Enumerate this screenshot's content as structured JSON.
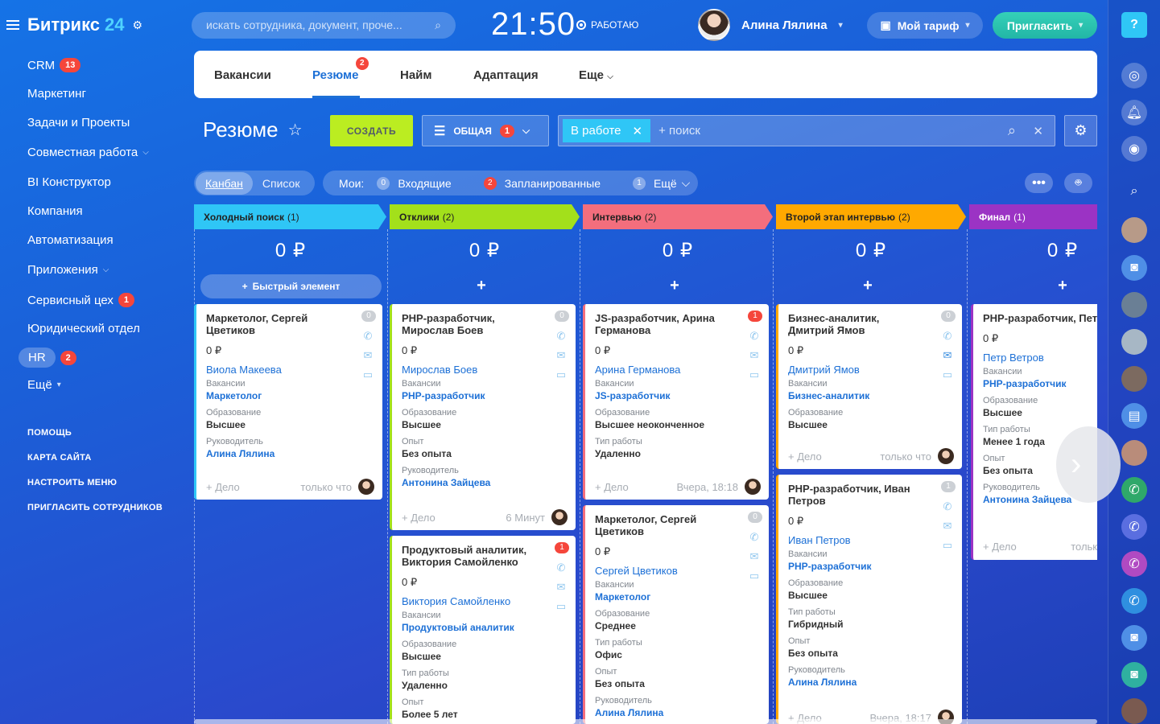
{
  "logo": {
    "name": "Битрикс",
    "num": "24"
  },
  "sidebar": {
    "items": [
      {
        "label": "CRM",
        "badge": "13"
      },
      {
        "label": "Маркетинг"
      },
      {
        "label": "Задачи и Проекты"
      },
      {
        "label": "Совместная работа"
      },
      {
        "label": "BI Конструктор"
      },
      {
        "label": "Компания"
      },
      {
        "label": "Автоматизация"
      },
      {
        "label": "Приложения"
      },
      {
        "label": "Сервисный цех",
        "badge": "1"
      },
      {
        "label": "Юридический отдел"
      },
      {
        "label": "HR",
        "badge": "2"
      },
      {
        "label": "Ещё"
      }
    ],
    "links": [
      "ПОМОЩЬ",
      "КАРТА САЙТА",
      "НАСТРОИТЬ МЕНЮ",
      "ПРИГЛАСИТЬ СОТРУДНИКОВ"
    ]
  },
  "header": {
    "search_placeholder": "искать сотрудника, документ, проче...",
    "clock": "21:50",
    "work_status": "РАБОТАЮ",
    "user_name": "Алина Лялина",
    "tariff": "Мой тариф",
    "invite": "Пригласить"
  },
  "tabs": [
    {
      "label": "Вакансии"
    },
    {
      "label": "Резюме",
      "badge": "2"
    },
    {
      "label": "Найм"
    },
    {
      "label": "Адаптация"
    },
    {
      "label": "Еще"
    }
  ],
  "toolbar": {
    "title": "Резюме",
    "create": "СОЗДАТЬ",
    "filter": "ОБЩАЯ",
    "filter_count": "1",
    "chip": "В работе",
    "search_placeholder": "+ поиск"
  },
  "view": {
    "kanban": "Канбан",
    "list": "Список",
    "mine": "Мои:",
    "incoming": "Входящие",
    "incoming_count": "0",
    "planned": "Запланированные",
    "planned_count": "2",
    "more": "Ещё",
    "more_count": "1"
  },
  "quick_add": "Быстрый элемент",
  "columns": [
    {
      "name": "Холодный поиск",
      "count": "(1)",
      "sum": "0 ₽",
      "color": "#2fc6f6"
    },
    {
      "name": "Отклики",
      "count": "(2)",
      "sum": "0 ₽",
      "color": "#a3e01b"
    },
    {
      "name": "Интервью",
      "count": "(2)",
      "sum": "0 ₽",
      "color": "#f36e7d"
    },
    {
      "name": "Второй этап интервью",
      "count": "(2)",
      "sum": "0 ₽",
      "color": "#ffa900"
    },
    {
      "name": "Финал",
      "count": "(1)",
      "sum": "0 ₽",
      "color": "#9b33c4"
    }
  ],
  "cards": {
    "c1": {
      "title": "Маркетолог, Сергей Цветиков",
      "sum": "0 ₽",
      "contact": "Виола Макеева",
      "badge": "0",
      "l1": "Вакансии",
      "v1": "Маркетолог",
      "l2": "Образование",
      "v2": "Высшее",
      "l3": "Руководитель",
      "v3": "Алина Лялина",
      "add": "+ Дело",
      "time": "только что"
    },
    "c2": {
      "title": "PHP-разработчик, Мирослав Боев",
      "sum": "0 ₽",
      "contact": "Мирослав Боев",
      "badge": "0",
      "l1": "Вакансии",
      "v1": "PHP-разработчик",
      "l2": "Образование",
      "v2": "Высшее",
      "l3": "Опыт",
      "v3": "Без опыта",
      "l4": "Руководитель",
      "v4": "Антонина Зайцева",
      "add": "+ Дело",
      "time": "6 Минут"
    },
    "c3": {
      "title": "Продуктовый аналитик, Виктория Самойленко",
      "sum": "0 ₽",
      "contact": "Виктория Самойленко",
      "badge": "1",
      "l1": "Вакансии",
      "v1": "Продуктовый аналитик",
      "l2": "Образование",
      "v2": "Высшее",
      "l3": "Тип работы",
      "v3": "Удаленно",
      "l4": "Опыт",
      "v4": "Более 5 лет"
    },
    "c4": {
      "title": "JS-разработчик, Арина Германова",
      "sum": "0 ₽",
      "contact": "Арина Германова",
      "badge": "1",
      "l1": "Вакансии",
      "v1": "JS-разработчик",
      "l2": "Образование",
      "v2": "Высшее неоконченное",
      "l3": "Тип работы",
      "v3": "Удаленно",
      "add": "+ Дело",
      "time": "Вчера, 18:18"
    },
    "c5": {
      "title": "Маркетолог, Сергей Цветиков",
      "sum": "0 ₽",
      "contact": "Сергей Цветиков",
      "badge": "0",
      "l1": "Вакансии",
      "v1": "Маркетолог",
      "l2": "Образование",
      "v2": "Среднее",
      "l3": "Тип работы",
      "v3": "Офис",
      "l4": "Опыт",
      "v4": "Без опыта",
      "l5": "Руководитель",
      "v5": "Алина Лялина"
    },
    "c6": {
      "title": "Бизнес-аналитик, Дмитрий Ямов",
      "sum": "0 ₽",
      "contact": "Дмитрий Ямов",
      "badge": "0",
      "l1": "Вакансии",
      "v1": "Бизнес-аналитик",
      "l2": "Образование",
      "v2": "Высшее",
      "add": "+ Дело",
      "time": "только что"
    },
    "c7": {
      "title": "PHP-разработчик, Иван Петров",
      "sum": "0 ₽",
      "contact": "Иван Петров",
      "badge": "1",
      "l1": "Вакансии",
      "v1": "PHP-разработчик",
      "l2": "Образование",
      "v2": "Высшее",
      "l3": "Тип работы",
      "v3": "Гибридный",
      "l4": "Опыт",
      "v4": "Без опыта",
      "l5": "Руководитель",
      "v5": "Алина Лялина",
      "add": "+ Дело",
      "time": "Вчера, 18:17"
    },
    "c8": {
      "title": "PHP-разработчик, Петр Ветров",
      "sum": "0 ₽",
      "contact": "Петр Ветров",
      "badge": "",
      "l1": "Вакансии",
      "v1": "PHP-разработчик",
      "l2": "Образование",
      "v2": "Высшее",
      "l3": "Тип работы",
      "v3": "Менее 1 года",
      "l4": "Опыт",
      "v4": "Без опыта",
      "l5": "Руководитель",
      "v5": "Антонина Зайцева",
      "add": "+ Дело",
      "time": "тольк"
    }
  }
}
